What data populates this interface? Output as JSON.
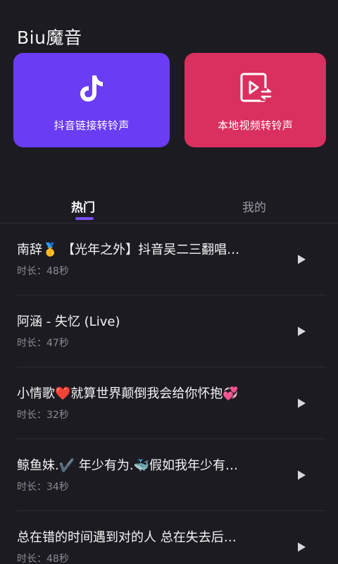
{
  "header": {
    "app_title": "Biu魔音"
  },
  "cards": [
    {
      "label": "抖音链接转铃声",
      "icon": "tiktok-icon",
      "color": "#6a3cf4"
    },
    {
      "label": "本地视频转铃声",
      "icon": "video-convert-icon",
      "color": "#d9305f"
    }
  ],
  "tabs": [
    {
      "label": "热门",
      "active": true
    },
    {
      "label": "我的",
      "active": false
    }
  ],
  "accent_color": "#7a4cff",
  "songs": [
    {
      "title": "南辞🥇 【光年之外】抖音吴二三翻唱…",
      "duration": "时长：48秒"
    },
    {
      "title": "阿涵 - 失忆 (Live)",
      "duration": "时长：47秒"
    },
    {
      "title": "小情歌❤️就算世界颠倒我会给你怀抱💞",
      "duration": "时长：32秒"
    },
    {
      "title": "鲸鱼妹.✔️ 年少有为.🐳假如我年少有…",
      "duration": "时长：34秒"
    },
    {
      "title": "总在错的时间遇到对的人 总在失去后…",
      "duration": "时长：48秒"
    }
  ]
}
